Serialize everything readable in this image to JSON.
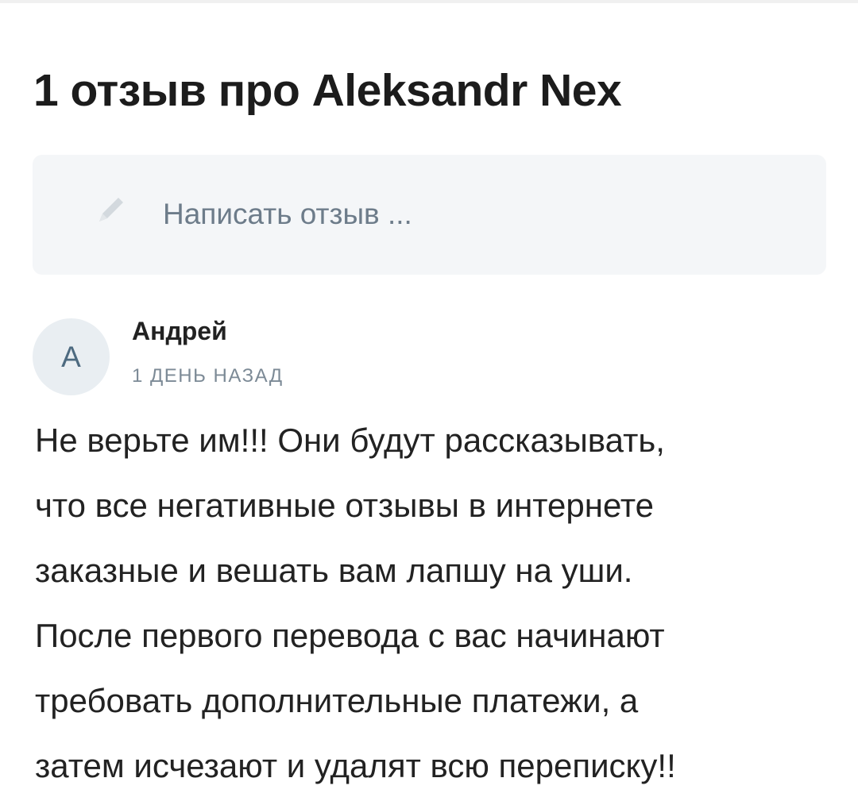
{
  "page": {
    "title": "1 отзыв про Aleksandr Nex"
  },
  "compose": {
    "placeholder": "Написать отзыв ...",
    "icon": "pencil-icon"
  },
  "reviews": [
    {
      "avatar_letter": "А",
      "author": "Андрей",
      "date": "1 ДЕНЬ НАЗАД",
      "lines": [
        "Не верьте им!!! Они будут рассказывать,",
        "что все негативные отзывы в интернете",
        "заказные и вешать вам лапшу на уши.",
        "После первого перевода с вас начинают",
        "требовать дополнительные платежи, а",
        "затем исчезают и удалят всю переписку!!"
      ]
    }
  ],
  "colors": {
    "compose_background": "#f4f6f8",
    "placeholder_text": "#6d7c8a",
    "avatar_background": "#e9eef2",
    "avatar_letter": "#4d6a80",
    "meta_text": "#7c8a96"
  }
}
